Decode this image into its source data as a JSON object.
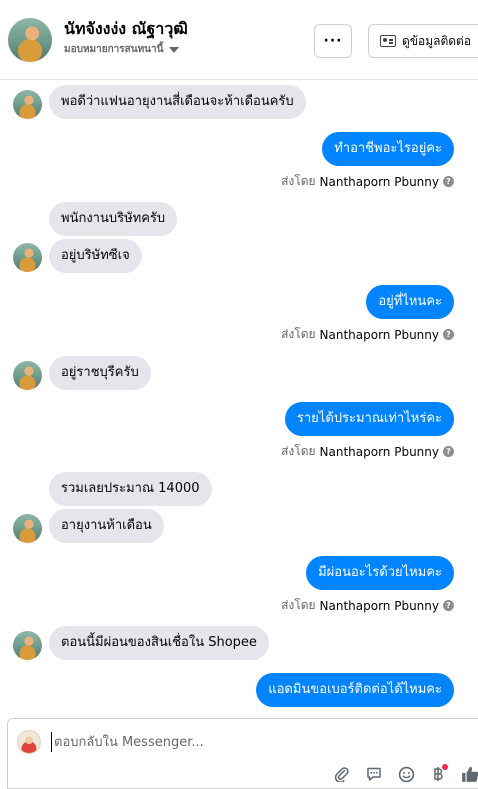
{
  "header": {
    "name": "นัทจังงง่ง ณัฐาวุฒิ",
    "subtitle": "มอบหมายการสนทนานี้",
    "more_label": "···",
    "info_label": "ดูข้อมูลติดต่อ"
  },
  "messages": [
    {
      "dir": "in",
      "text": "พอดีว่าแฟนอายุงานสี่เดือนจะห้าเดือนครับ"
    },
    {
      "dir": "out",
      "text": "ทำอาชีพอะไรอยู่คะ",
      "sent_prefix": "ส่งโดย",
      "sender": "Nanthaporn Pbunny"
    },
    {
      "dir": "in",
      "text": "พนักงานบริษัทครับ"
    },
    {
      "dir": "in",
      "text": "อยู่บริษัทซีเจ"
    },
    {
      "dir": "out",
      "text": "อยู่ที่ไหนคะ",
      "sent_prefix": "ส่งโดย",
      "sender": "Nanthaporn Pbunny"
    },
    {
      "dir": "in",
      "text": "อยู่ราชบุรีครับ"
    },
    {
      "dir": "out",
      "text": "รายได้ประมาณเท่าไหร่คะ",
      "sent_prefix": "ส่งโดย",
      "sender": "Nanthaporn Pbunny"
    },
    {
      "dir": "in",
      "text": "รวมเลยประมาณ 14000"
    },
    {
      "dir": "in",
      "text": "อายุงานห้าเดือน"
    },
    {
      "dir": "out",
      "text": "มีผ่อนอะไรด้วยไหมคะ",
      "sent_prefix": "ส่งโดย",
      "sender": "Nanthaporn Pbunny"
    },
    {
      "dir": "in",
      "text": "ตอนนี้มีผ่อนของสินเชื่อใน Shopee"
    },
    {
      "dir": "out",
      "text": "แอดมินขอเบอร์ติดต่อได้ไหมคะ"
    }
  ],
  "composer": {
    "placeholder": "ตอบกลับใน Messenger...",
    "tools": [
      "attachment-icon",
      "comment-icon",
      "emoji-icon",
      "currency-icon",
      "thumbs-up-icon"
    ]
  },
  "colors": {
    "outgoing_bubble": "#0084ff",
    "incoming_bubble": "#e4e6eb",
    "notification_dot": "#f02849"
  }
}
